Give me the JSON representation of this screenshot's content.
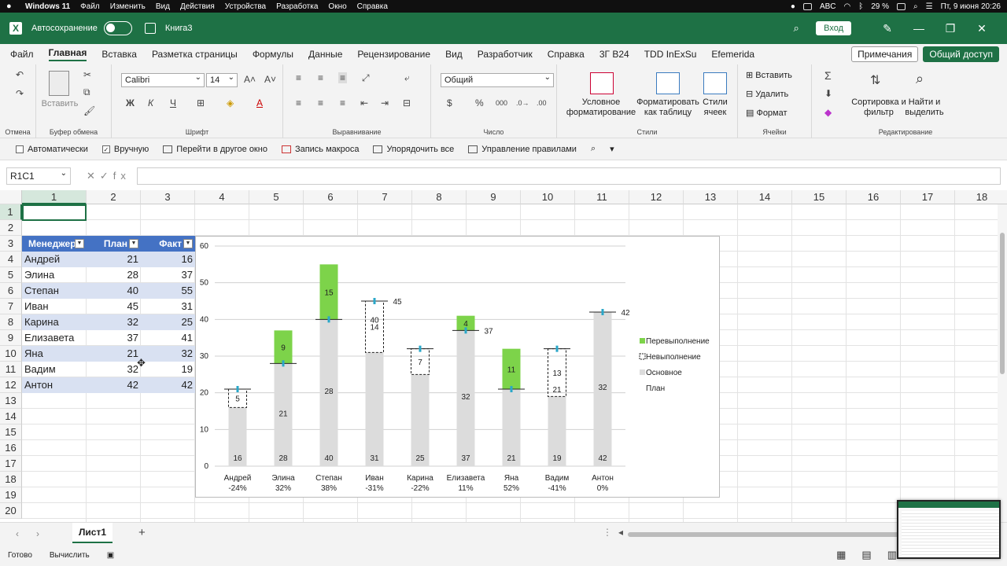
{
  "macbar": {
    "app": "Windows 11",
    "menus": [
      "Файл",
      "Изменить",
      "Вид",
      "Действия",
      "Устройства",
      "Разработка",
      "Окно",
      "Справка"
    ],
    "keyboard": "ABC",
    "battery": "29 %",
    "datetime": "Пт, 9 июня  20:26"
  },
  "titlebar": {
    "autosave_label": "Автосохранение",
    "doc_name": "Книга3",
    "login_label": "Вход"
  },
  "tabs": {
    "items": [
      "Файл",
      "Главная",
      "Вставка",
      "Разметка страницы",
      "Формулы",
      "Данные",
      "Рецензирование",
      "Вид",
      "Разработчик",
      "Справка",
      "3Г B24",
      "TDD InExSu",
      "Efemerida"
    ],
    "active": "Главная",
    "notes_label": "Примечания",
    "share_label": "Общий доступ"
  },
  "ribbon": {
    "undo_group": "Отмена",
    "clipboard_group": "Буфер обмена",
    "paste_label": "Вставить",
    "font_group": "Шрифт",
    "font_name": "Calibri",
    "font_size": "14",
    "align_group": "Выравнивание",
    "number_group": "Число",
    "number_format": "Общий",
    "styles_group": "Стили",
    "cond_format": "Условное форматирование",
    "format_table": "Форматировать как таблицу",
    "cell_styles": "Стили ячеек",
    "cells_group": "Ячейки",
    "insert": "Вставить",
    "delete": "Удалить",
    "format": "Формат",
    "edit_group": "Редактирование",
    "sort_filter": "Сортировка и фильтр",
    "find_select": "Найти и выделить"
  },
  "qat": {
    "auto": "Автоматически",
    "manual": "Вручную",
    "goto_window": "Перейти в другое окно",
    "record_macro": "Запись макроса",
    "arrange_all": "Упорядочить все",
    "manage_rules": "Управление правилами"
  },
  "formula_bar": {
    "name_box": "R1C1",
    "formula": ""
  },
  "columns": [
    "1",
    "2",
    "3",
    "4",
    "5",
    "6",
    "7",
    "8",
    "9",
    "10",
    "11",
    "12",
    "13",
    "14",
    "15",
    "16",
    "17",
    "18"
  ],
  "rows": [
    "1",
    "2",
    "3",
    "4",
    "5",
    "6",
    "7",
    "8",
    "9",
    "10",
    "11",
    "12",
    "13",
    "14",
    "15",
    "16",
    "17",
    "18",
    "19",
    "20"
  ],
  "table": {
    "headers": [
      "Менеджер",
      "План",
      "Факт"
    ],
    "rows": [
      [
        "Андрей",
        "21",
        "16"
      ],
      [
        "Элина",
        "28",
        "37"
      ],
      [
        "Степан",
        "40",
        "55"
      ],
      [
        "Иван",
        "45",
        "31"
      ],
      [
        "Карина",
        "32",
        "25"
      ],
      [
        "Елизавета",
        "37",
        "41"
      ],
      [
        "Яна",
        "21",
        "32"
      ],
      [
        "Вадим",
        "32",
        "19"
      ],
      [
        "Антон",
        "42",
        "42"
      ]
    ]
  },
  "chart_data": {
    "type": "bar",
    "stacked": true,
    "categories": [
      "Андрей",
      "Элина",
      "Степан",
      "Иван",
      "Карина",
      "Елизавета",
      "Яна",
      "Вадим",
      "Антон"
    ],
    "pct_labels": [
      "-24%",
      "32%",
      "38%",
      "-31%",
      "-22%",
      "11%",
      "52%",
      "-41%",
      "0%"
    ],
    "series": [
      {
        "name": "Основное",
        "values": [
          16,
          28,
          40,
          31,
          25,
          37,
          21,
          19,
          42
        ]
      },
      {
        "name": "Перевыполнение",
        "values": [
          0,
          9,
          15,
          0,
          0,
          4,
          11,
          0,
          0
        ]
      },
      {
        "name": "Невыполнение",
        "values": [
          5,
          0,
          0,
          14,
          7,
          0,
          0,
          13,
          0
        ]
      },
      {
        "name": "План",
        "values": [
          21,
          28,
          40,
          45,
          32,
          37,
          21,
          32,
          42
        ]
      }
    ],
    "base_labels": [
      "16",
      "28",
      "40",
      "31",
      "25",
      "37",
      "21",
      "19",
      "42"
    ],
    "mid_labels": [
      "",
      "21",
      "28",
      "",
      "",
      "32",
      "",
      "",
      "32"
    ],
    "diff_labels": [
      "5",
      "9",
      "15",
      "14",
      "7",
      "4",
      "11",
      "13",
      ""
    ],
    "plan_labels": [
      "",
      "",
      "",
      "45",
      "",
      "37",
      "",
      "",
      "42"
    ],
    "extra_labels": [
      "",
      "",
      "",
      "40",
      "",
      "",
      "",
      "21",
      ""
    ],
    "legend": [
      "Перевыполнение",
      "Невыполнение",
      "Основное",
      "План"
    ],
    "ylim": [
      0,
      60
    ],
    "yticks": [
      "0",
      "10",
      "20",
      "30",
      "40",
      "50",
      "60"
    ],
    "grid": true,
    "legend_position": "right",
    "colors": {
      "base": "#dcdcdc",
      "over": "#7dd34a",
      "plan": "#2aa7c9",
      "grid": "#d0d0d0"
    }
  },
  "sheetbar": {
    "sheet_name": "Лист1"
  },
  "statusbar": {
    "ready": "Готово",
    "calculate": "Вычислить"
  }
}
